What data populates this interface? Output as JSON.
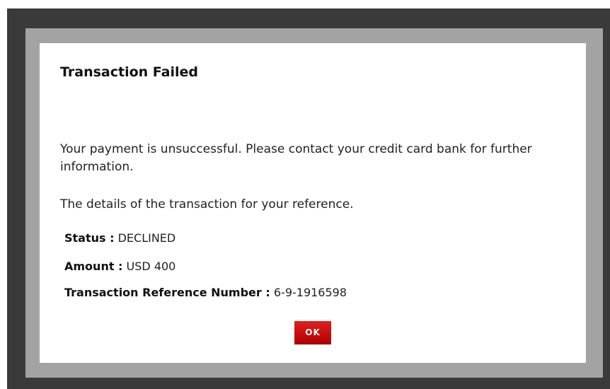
{
  "dialog": {
    "title": "Transaction Failed",
    "message": "Your payment is unsuccessful. Please contact your credit card bank for further information.",
    "details_intro": "The details of the transaction for your reference.",
    "details": [
      {
        "label": "Status :",
        "value": "DECLINED"
      },
      {
        "label": "Amount :",
        "value": "USD 400"
      },
      {
        "label": "Transaction Reference Number :",
        "value": "6-9-1916598"
      }
    ],
    "ok_label": "OK"
  },
  "colors": {
    "backdrop": "#3a3a3a",
    "frame": "#a3a3a3",
    "dialog_bg": "#ffffff",
    "button_red": "#c80000"
  }
}
